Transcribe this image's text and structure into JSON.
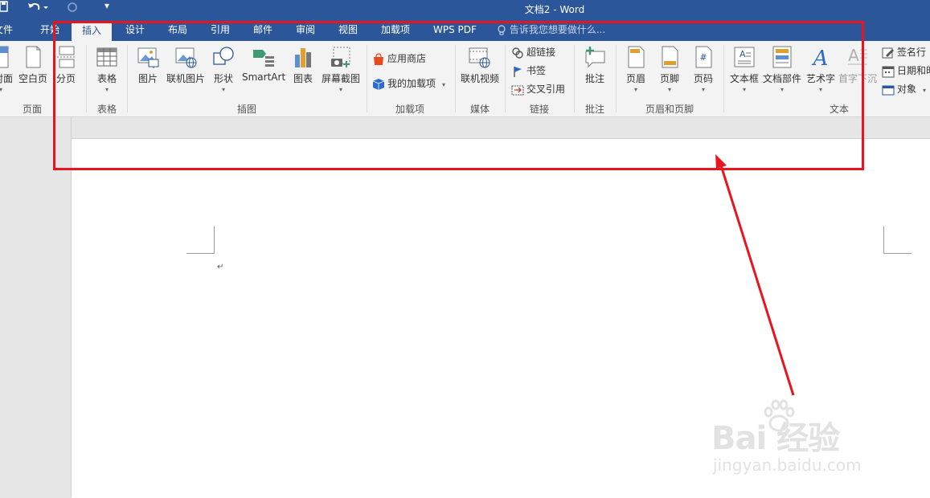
{
  "window": {
    "title": "文档2 - Word"
  },
  "tabs": [
    {
      "label": "文件"
    },
    {
      "label": "开始"
    },
    {
      "label": "插入"
    },
    {
      "label": "设计"
    },
    {
      "label": "布局"
    },
    {
      "label": "引用"
    },
    {
      "label": "邮件"
    },
    {
      "label": "审阅"
    },
    {
      "label": "视图"
    },
    {
      "label": "加载项"
    },
    {
      "label": "WPS PDF"
    }
  ],
  "tell_me": "告诉我您想要做什么...",
  "ribbon": {
    "pages": {
      "cover": "封面",
      "blank": "空白页",
      "break": "分页",
      "group": "页面"
    },
    "tables": {
      "table": "表格",
      "group": "表格"
    },
    "illustrations": {
      "pictures": "图片",
      "online_pictures": "联机图片",
      "shapes": "形状",
      "smartart": "SmartArt",
      "chart": "图表",
      "screenshot": "屏幕截图",
      "group": "插图"
    },
    "addins": {
      "store": "应用商店",
      "my_addins": "我的加载项",
      "group": "加载项"
    },
    "media": {
      "online_video": "联机视频",
      "group": "媒体"
    },
    "links": {
      "hyperlink": "超链接",
      "bookmark": "书签",
      "cross_ref": "交叉引用",
      "group": "链接"
    },
    "comments": {
      "comment": "批注",
      "group": "批注"
    },
    "header_footer": {
      "header": "页眉",
      "footer": "页脚",
      "page_number": "页码",
      "group": "页眉和页脚"
    },
    "text": {
      "textbox": "文本框",
      "quick_parts": "文档部件",
      "wordart": "艺术字",
      "dropcap": "首字下沉",
      "signature": "签名行",
      "datetime": "日期和时间",
      "object": "对象",
      "group": "文本"
    }
  },
  "watermark": {
    "line1": "Bai 经验",
    "line2": "jingyan.baidu.com"
  },
  "colors": {
    "brand": "#2b579a",
    "highlight": "#e8141e"
  }
}
